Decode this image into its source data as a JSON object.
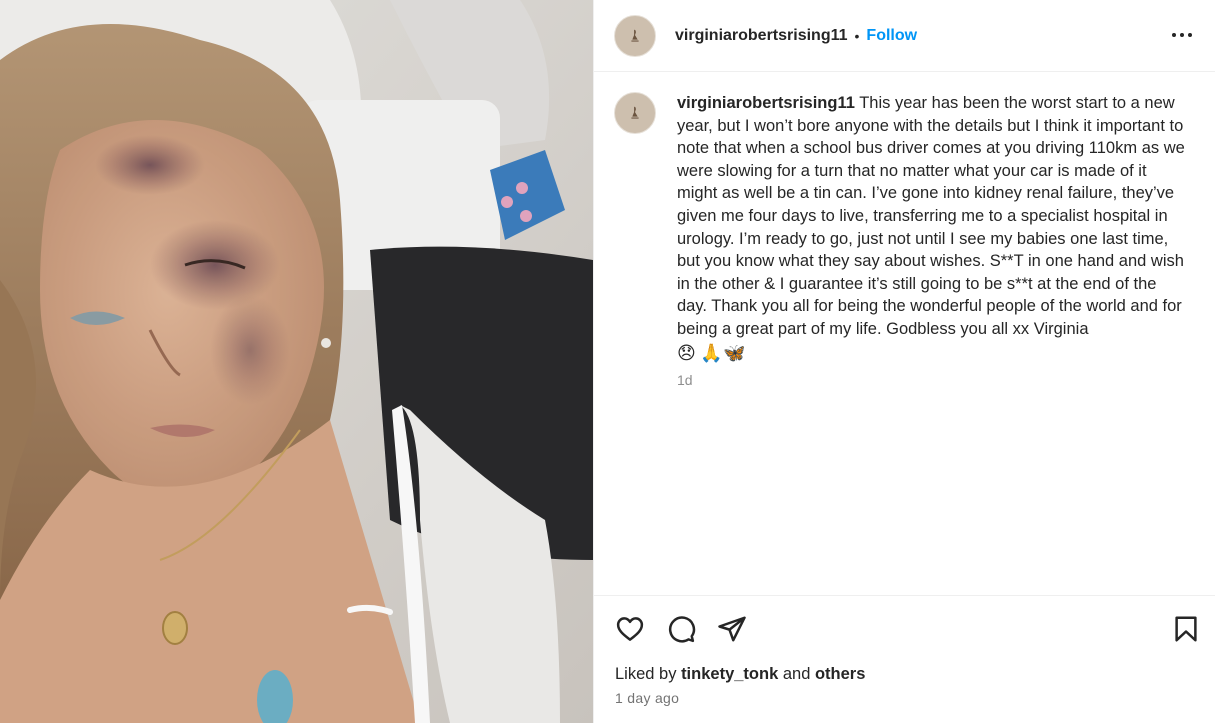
{
  "post": {
    "username": "virginiarobertsrising11",
    "separator": "•",
    "follow_label": "Follow",
    "photo_alt": "Photo"
  },
  "caption": {
    "username": "virginiarobertsrising11",
    "text": "This year has been the worst start to a new year, but I won’t bore anyone with the details but I think it important to note that when a school bus driver comes at you driving 110km as we were slowing for a turn that no matter what your car is made of it might as well be a tin can. I’ve gone into kidney renal failure, they’ve given me four days to live, transferring me to a specialist hospital in urology. I’m ready to go, just not until I see my babies one last time, but you know what they say about wishes. S**T in one hand and wish in the other & I guarantee it’s still going to be s**t at the end of the day. Thank you all for being the wonderful people of the world and for being a great part of my life. Godbless you all xx Virginia",
    "emojis": [
      "😞",
      "🙏",
      "🦋"
    ],
    "time": "1d"
  },
  "actions": {
    "like_icon": "heart-icon",
    "comment_icon": "comment-icon",
    "share_icon": "paper-plane-icon",
    "save_icon": "bookmark-icon"
  },
  "likes": {
    "prefix": "Liked by",
    "user": "tinkety_tonk",
    "and": "and",
    "others": "others"
  },
  "timestamp": "1 day ago",
  "colors": {
    "accent": "#0095f6",
    "text": "#262626",
    "muted": "#8e8e8e",
    "border": "#efefef"
  }
}
